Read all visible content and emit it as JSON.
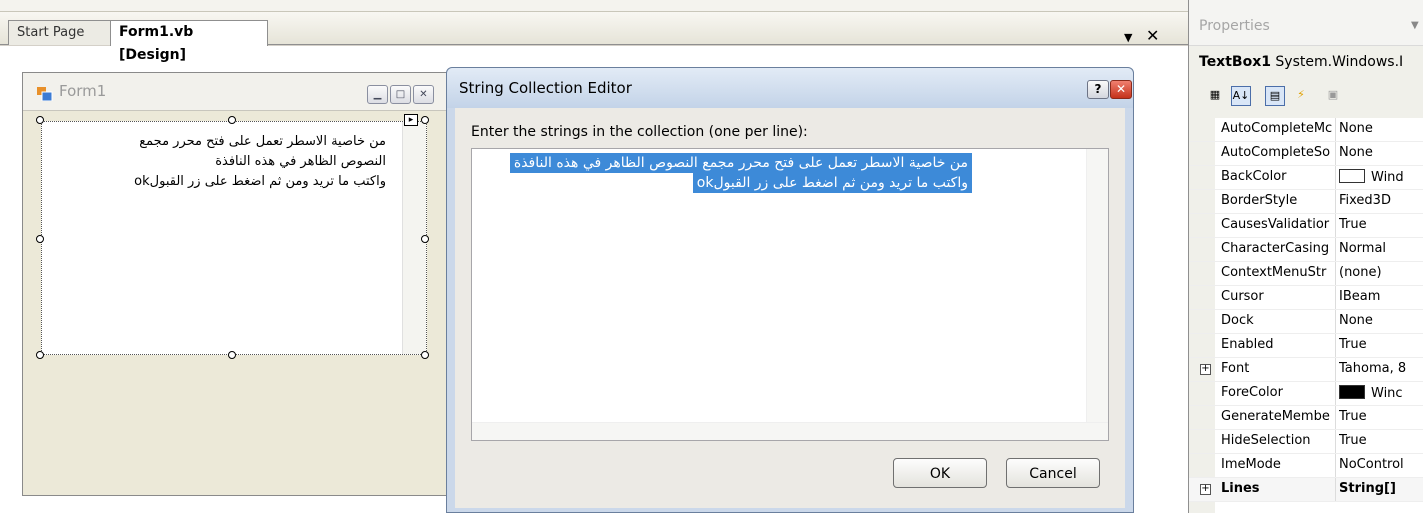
{
  "tabs": {
    "start_page": "Start Page",
    "form_design": "Form1.vb [Design]"
  },
  "form1": {
    "title": "Form1",
    "minimize": "▁",
    "maximize": "□",
    "close": "✕",
    "textbox_lines": [
      "من خاصية الاسطر تعمل على فتح محرر مجمع",
      "النصوص الظاهر في هذه النافذة",
      "واكتب ما تريد ومن ثم اضغط على زر القبولok"
    ]
  },
  "dialog": {
    "title": "String Collection Editor",
    "help": "?",
    "close": "✕",
    "prompt": "Enter the strings in the collection (one per line):",
    "lines": [
      "من خاصية الاسطر تعمل على فتح محرر مجمع النصوص الظاهر في هذه النافذة",
      "واكتب ما تريد ومن ثم اضغط على زر القبولok"
    ],
    "ok": "OK",
    "cancel": "Cancel"
  },
  "properties": {
    "title": "Properties",
    "object_name": "TextBox1",
    "object_type": "System.Windows.I",
    "rows": [
      {
        "name": "AutoCompleteMc",
        "value": "None"
      },
      {
        "name": "AutoCompleteSo",
        "value": "None"
      },
      {
        "name": "BackColor",
        "value": "Wind",
        "swatch": "#ffffff"
      },
      {
        "name": "BorderStyle",
        "value": "Fixed3D"
      },
      {
        "name": "CausesValidatior",
        "value": "True"
      },
      {
        "name": "CharacterCasing",
        "value": "Normal"
      },
      {
        "name": "ContextMenuStr",
        "value": "(none)"
      },
      {
        "name": "Cursor",
        "value": "IBeam"
      },
      {
        "name": "Dock",
        "value": "None"
      },
      {
        "name": "Enabled",
        "value": "True"
      },
      {
        "name": "Font",
        "value": "Tahoma, 8",
        "expander": "+"
      },
      {
        "name": "ForeColor",
        "value": "Winc",
        "swatch": "#000000"
      },
      {
        "name": "GenerateMembe",
        "value": "True"
      },
      {
        "name": "HideSelection",
        "value": "True"
      },
      {
        "name": "ImeMode",
        "value": "NoControl"
      },
      {
        "name": "Lines",
        "value": "String[] ",
        "expander": "+",
        "selected": true
      }
    ]
  },
  "icons": {
    "categorized": "categorized-icon",
    "alphabetical": "alphabetical-icon",
    "properties_view": "properties-view-icon",
    "events": "events-icon",
    "property_pages": "property-pages-icon"
  }
}
